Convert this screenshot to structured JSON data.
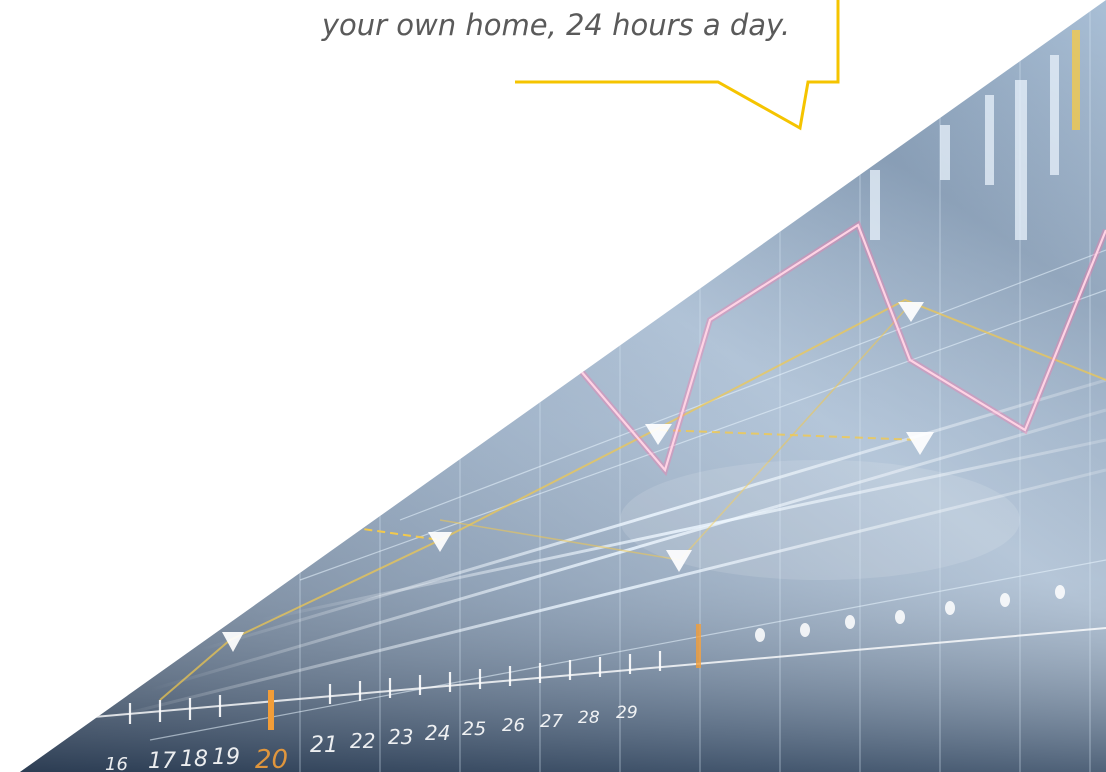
{
  "callout": {
    "text": "your own home, 24 hours a day.",
    "border_color": "#f5c400"
  },
  "hero": {
    "description": "Diagonal stock-chart photo with glowing grid lines, a pink trend line, yellow trend lines with triangle markers, and a numbered axis.",
    "axis_labels": [
      "16",
      "17",
      "18",
      "19",
      "20",
      "21",
      "22",
      "23",
      "24",
      "25",
      "26",
      "27",
      "28",
      "29"
    ],
    "highlight_label": "20",
    "colors": {
      "pink_line": "#ff6fa6",
      "yellow_line": "#f2c94c",
      "highlight": "#f29d38",
      "bg_dark": "#2b3d55",
      "bg_light": "#a9bfd6"
    }
  }
}
